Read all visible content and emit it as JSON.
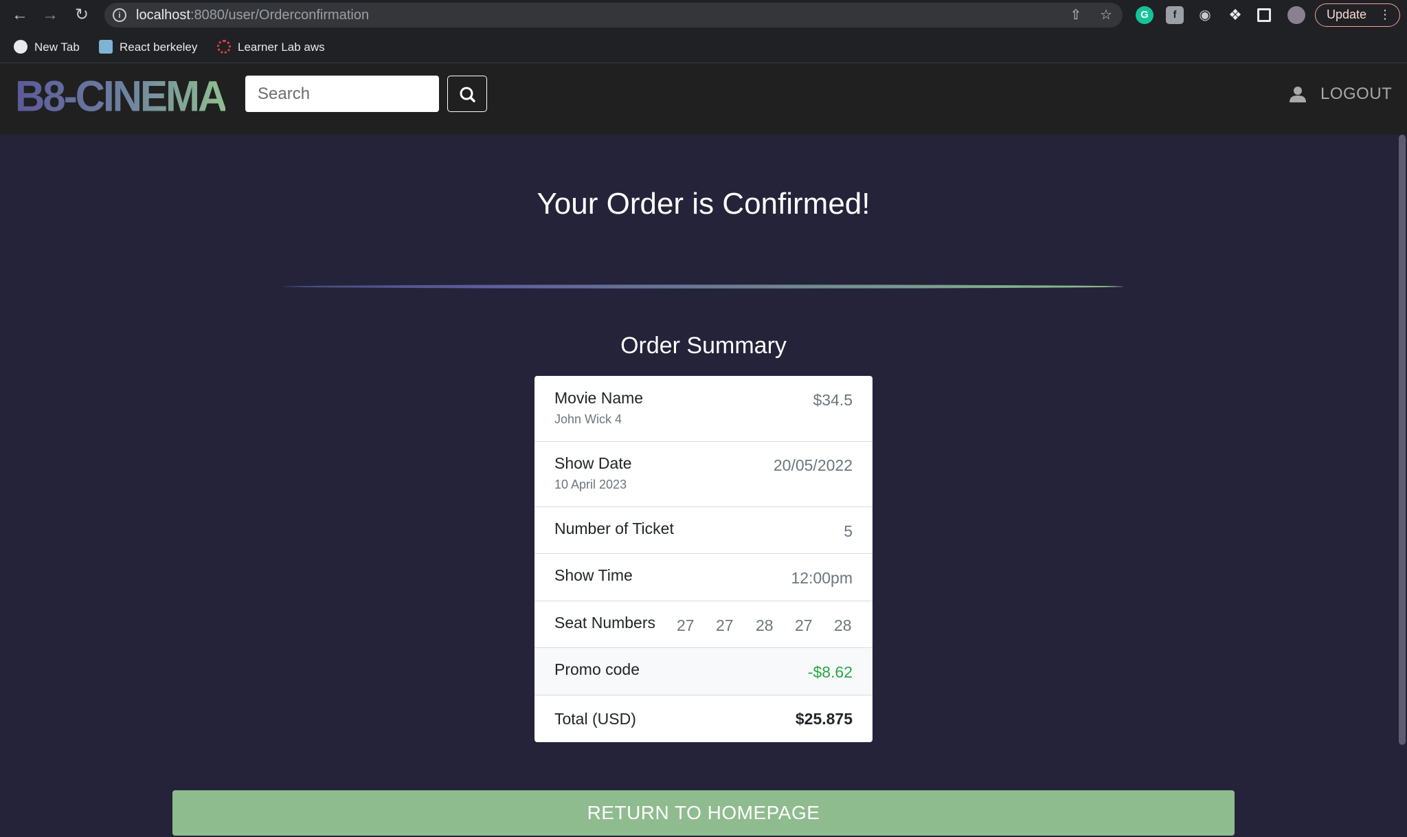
{
  "browser": {
    "url_host": "localhost",
    "url_path": ":8080/user/Orderconfirmation",
    "update_label": "Update",
    "bookmarks": [
      {
        "label": "New Tab"
      },
      {
        "label": "React berkeley"
      },
      {
        "label": "Learner Lab aws"
      }
    ]
  },
  "header": {
    "logo": "B8-CINEMA",
    "search_placeholder": "Search",
    "logout_label": "LOGOUT"
  },
  "main": {
    "title": "Your Order is Confirmed!",
    "summary_title": "Order Summary",
    "rows": {
      "movie": {
        "label": "Movie Name",
        "sub": "John Wick 4",
        "value": "$34.5"
      },
      "date": {
        "label": "Show Date",
        "sub": "10 April 2023",
        "value": "20/05/2022"
      },
      "tickets": {
        "label": "Number of Ticket",
        "value": "5"
      },
      "time": {
        "label": "Show Time",
        "value": "12:00pm"
      },
      "seats": {
        "label": "Seat Numbers",
        "values": [
          "27",
          "27",
          "28",
          "27",
          "28"
        ]
      },
      "promo": {
        "label": "Promo code",
        "value": "-$8.62"
      },
      "total": {
        "label": "Total (USD)",
        "value": "$25.875"
      }
    },
    "return_label": "RETURN TO HOMEPAGE"
  },
  "colors": {
    "page_bg": "#24233a",
    "header_bg": "#202020",
    "return_button": "#8fbc8f",
    "promo_value": "#28a745"
  }
}
